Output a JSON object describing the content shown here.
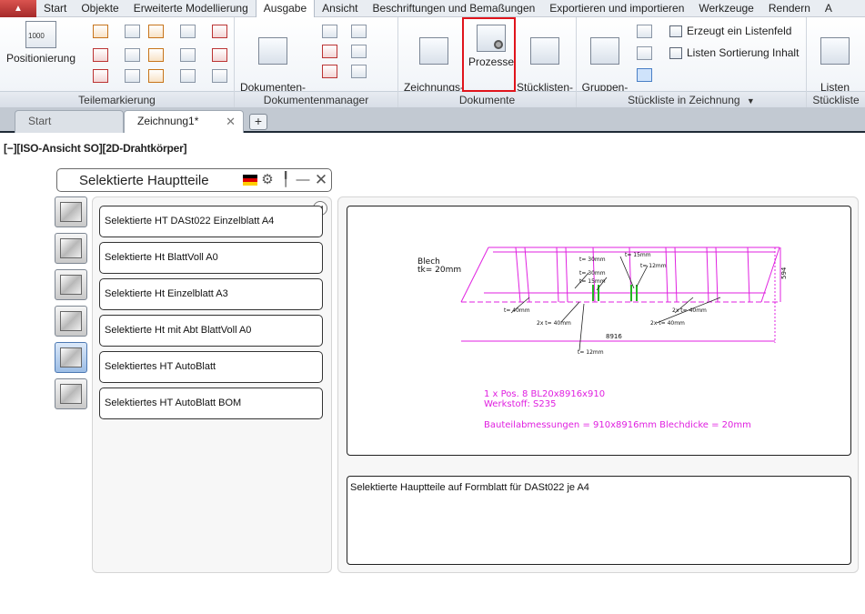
{
  "menubar": {
    "items": [
      "Start",
      "Objekte",
      "Erweiterte Modellierung",
      "Ausgabe",
      "Ansicht",
      "Beschriftungen und Bemaßungen",
      "Exportieren und importieren",
      "Werkzeuge",
      "Rendern",
      "A"
    ],
    "active_index": 3
  },
  "ribbon": {
    "teilemarkierung": {
      "title": "Teilemarkierung",
      "positionierung_label": "Positionierung",
      "positionierung_icon_text": "1000"
    },
    "dokumentenmanager": {
      "title": "Dokumentenmanager",
      "manager_label": "Dokumenten-\nManager"
    },
    "dokumente": {
      "title": "Dokumente",
      "zeichnungsstile_label": "Zeichnungs-\nStile",
      "prozesse_label": "Prozesse",
      "stuecklistenvorlagen_label": "Stücklisten-\nVorlagen"
    },
    "stueckliste_zeichnung": {
      "title": "Stückliste in Zeichnung",
      "gruppenmanager_label": "Gruppen-\nManager",
      "erzeugt_label": "Erzeugt ein Listenfeld",
      "sortierung_label": "Listen Sortierung Inhalt"
    },
    "stueckliste": {
      "title": "Stückliste",
      "listen_erstellen_label": "Listen\nerstellen"
    }
  },
  "tabs": {
    "items": [
      "Start",
      "Zeichnung1*"
    ],
    "active_index": 1,
    "add_label": "+"
  },
  "viewport_label": "[−][ISO-Ansicht SO][2D-Drahtkörper]",
  "dialog": {
    "title": "Selektierte Hauptteile",
    "list": [
      "Selektierte HT DASt022 Einzelblatt A4",
      "Selektierte Ht BlattVoll A0",
      "Selektierte Ht Einzelblatt A3",
      "Selektierte Ht mit Abt BlattVoll A0",
      "Selektiertes HT AutoBlatt",
      "Selektiertes HT AutoBlatt BOM"
    ],
    "description": "Selektierte Hauptteile auf Formblatt für DASt022 je A4",
    "side_icons": [
      "profile-icon",
      "frame-icon",
      "camera-icon",
      "plate-icon",
      "assembly-icon",
      "camera-gray-icon"
    ],
    "active_side_icon": 4,
    "preview": {
      "blech_label": "Blech",
      "thickness_label": "tk= 20mm",
      "pos_text": "1 x Pos. 8 BL20x8916x910",
      "material_text": "Werkstoff: S235",
      "dims_text": "Bauteilabmessungen = 910x8916mm Blechdicke = 20mm",
      "length_dim": "8916",
      "height_dim": "594",
      "weld_labels": [
        "t= 15mm",
        "t= 12mm",
        "t= 30mm",
        "t= 30mm",
        "t= 15mm",
        "t= 40mm",
        "2x t= 40mm",
        "2x t= 40mm",
        "2x t= 40mm",
        "t= 12mm"
      ]
    }
  },
  "colors": {
    "accent_red": "#e0141c",
    "drawing_magenta": "#e020e0",
    "drawing_green": "#22b422"
  }
}
